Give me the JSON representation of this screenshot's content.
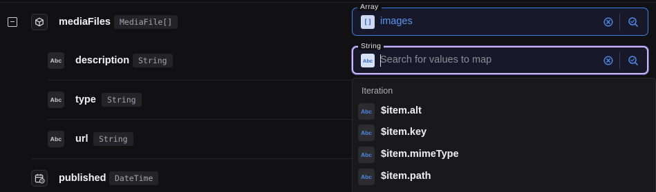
{
  "fields": {
    "media_files": {
      "name": "mediaFiles",
      "type": "MediaFile[]",
      "icon": "object-cube-icon"
    },
    "description": {
      "name": "description",
      "type": "String",
      "icon_text": "Abc"
    },
    "type": {
      "name": "type",
      "type": "String",
      "icon_text": "Abc"
    },
    "url": {
      "name": "url",
      "type": "String",
      "icon_text": "Abc"
    },
    "published": {
      "name": "published",
      "type": "DateTime",
      "icon": "calendar-clock-icon"
    }
  },
  "array_mapping": {
    "label": "Array",
    "icon_text": "[]",
    "value": "images"
  },
  "string_mapping": {
    "label": "String",
    "icon_text": "Abc",
    "placeholder": "Search for values to map"
  },
  "dropdown": {
    "heading": "Iteration",
    "items": [
      {
        "icon_text": "Abc",
        "label": "$item.alt"
      },
      {
        "icon_text": "Abc",
        "label": "$item.key"
      },
      {
        "icon_text": "Abc",
        "label": "$item.mimeType"
      },
      {
        "icon_text": "Abc",
        "label": "$item.path"
      }
    ]
  },
  "colors": {
    "background": "#111113",
    "accent_blue": "#3d82e3",
    "focus_border": "#cab7f4",
    "value_text": "#5b95ee"
  }
}
